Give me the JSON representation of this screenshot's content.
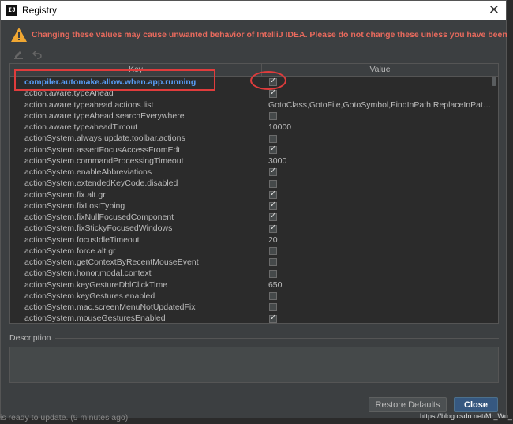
{
  "window": {
    "title": "Registry",
    "app_icon_label": "IJ"
  },
  "warning": {
    "text": "Changing these values may cause unwanted behavior of IntelliJ IDEA. Please do not change these unless you have been asked."
  },
  "table": {
    "headers": {
      "key": "Key",
      "value": "Value"
    },
    "rows": [
      {
        "key": "compiler.automake.allow.when.app.running",
        "type": "checkbox",
        "checked": true,
        "selected": true
      },
      {
        "key": "action.aware.typeAhead",
        "type": "checkbox",
        "checked": true
      },
      {
        "key": "action.aware.typeahead.actions.list",
        "type": "text",
        "value": "GotoClass,GotoFile,GotoSymbol,FindInPath,ReplaceInPath,FileSt..."
      },
      {
        "key": "action.aware.typeAhead.searchEverywhere",
        "type": "checkbox",
        "checked": false
      },
      {
        "key": "action.aware.typeaheadTimout",
        "type": "text",
        "value": "10000"
      },
      {
        "key": "actionSystem.always.update.toolbar.actions",
        "type": "checkbox",
        "checked": false
      },
      {
        "key": "actionSystem.assertFocusAccessFromEdt",
        "type": "checkbox",
        "checked": true
      },
      {
        "key": "actionSystem.commandProcessingTimeout",
        "type": "text",
        "value": "3000"
      },
      {
        "key": "actionSystem.enableAbbreviations",
        "type": "checkbox",
        "checked": true
      },
      {
        "key": "actionSystem.extendedKeyCode.disabled",
        "type": "checkbox",
        "checked": false
      },
      {
        "key": "actionSystem.fix.alt.gr",
        "type": "checkbox",
        "checked": true
      },
      {
        "key": "actionSystem.fixLostTyping",
        "type": "checkbox",
        "checked": true
      },
      {
        "key": "actionSystem.fixNullFocusedComponent",
        "type": "checkbox",
        "checked": true
      },
      {
        "key": "actionSystem.fixStickyFocusedWindows",
        "type": "checkbox",
        "checked": true
      },
      {
        "key": "actionSystem.focusIdleTimeout",
        "type": "text",
        "value": "20"
      },
      {
        "key": "actionSystem.force.alt.gr",
        "type": "checkbox",
        "checked": false
      },
      {
        "key": "actionSystem.getContextByRecentMouseEvent",
        "type": "checkbox",
        "checked": false
      },
      {
        "key": "actionSystem.honor.modal.context",
        "type": "checkbox",
        "checked": false
      },
      {
        "key": "actionSystem.keyGestureDblClickTime",
        "type": "text",
        "value": "650"
      },
      {
        "key": "actionSystem.keyGestures.enabled",
        "type": "checkbox",
        "checked": false
      },
      {
        "key": "actionSystem.mac.screenMenuNotUpdatedFix",
        "type": "checkbox",
        "checked": false
      },
      {
        "key": "actionSystem.mouseGesturesEnabled",
        "type": "checkbox",
        "checked": true
      }
    ]
  },
  "description": {
    "label": "Description",
    "text": ""
  },
  "buttons": {
    "restore": "Restore Defaults",
    "close": "Close"
  },
  "background": {
    "status_text": "is ready to update. (9 minutes ago)"
  },
  "watermark": "https://blog.csdn.net/Mr_Wu_",
  "colors": {
    "warning": "#e86a5d",
    "selected_key": "#589df6",
    "annotation": "#e03c3c",
    "primary_button": "#365880"
  }
}
